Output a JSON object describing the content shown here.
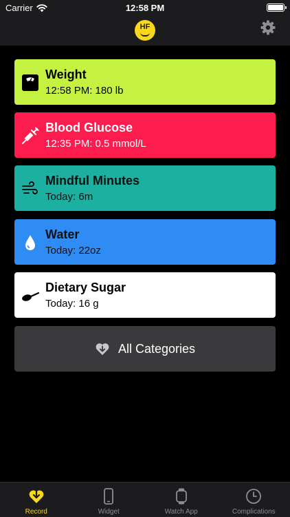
{
  "status_bar": {
    "carrier": "Carrier",
    "time": "12:58 PM"
  },
  "header": {
    "logo_text": "HF",
    "logo_color": "#f8d81c"
  },
  "cards": [
    {
      "title": "Weight",
      "value": "12:58 PM: 180 lb",
      "color": "#c5f241",
      "icon": "scale-icon"
    },
    {
      "title": "Blood Glucose",
      "value": "12:35 PM: 0.5 mmol/L",
      "color": "#fc1c4e",
      "icon": "syringe-icon"
    },
    {
      "title": "Mindful Minutes",
      "value": "Today: 6m",
      "color": "#1cb0a0",
      "icon": "wind-icon"
    },
    {
      "title": "Water",
      "value": "Today: 22oz",
      "color": "#2f8cf5",
      "icon": "water-drop-icon"
    },
    {
      "title": "Dietary Sugar",
      "value": "Today: 16 g",
      "color": "#ffffff",
      "icon": "spoon-icon"
    }
  ],
  "all_categories": {
    "label": "All Categories",
    "icon": "heart-download-icon"
  },
  "tabbar": {
    "active_color": "#f8d81c",
    "tabs": [
      {
        "label": "Record",
        "icon": "heart-download-icon",
        "active": true
      },
      {
        "label": "Widget",
        "icon": "phone-icon",
        "active": false
      },
      {
        "label": "Watch App",
        "icon": "watch-icon",
        "active": false
      },
      {
        "label": "Complications",
        "icon": "clock-icon",
        "active": false
      }
    ]
  }
}
